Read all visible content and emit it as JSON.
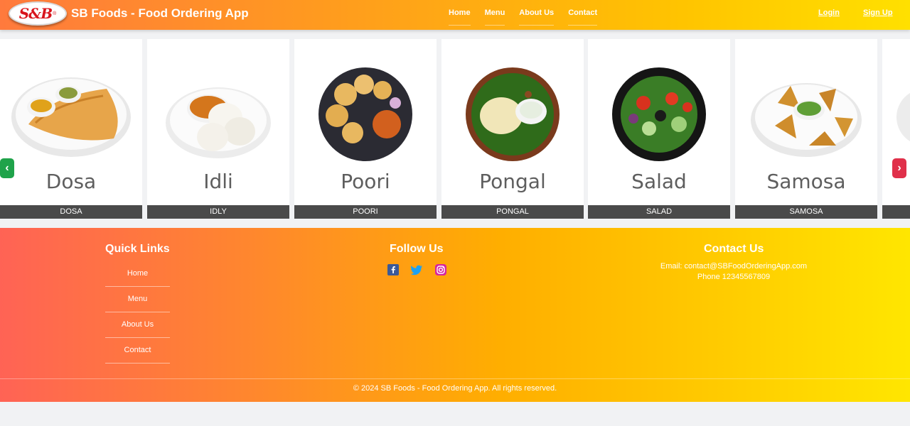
{
  "header": {
    "logo_text": "S&B",
    "brand": "SB Foods - Food Ordering App",
    "nav": [
      "Home",
      "Menu",
      "About Us",
      "Contact"
    ],
    "login": "Login",
    "signup": "Sign Up"
  },
  "carousel": {
    "items": [
      {
        "name": "Dosa",
        "caption": "DOSA"
      },
      {
        "name": "Idli",
        "caption": "IDLY"
      },
      {
        "name": "Poori",
        "caption": "POORI"
      },
      {
        "name": "Pongal",
        "caption": "PONGAL"
      },
      {
        "name": "Salad",
        "caption": "SALAD"
      },
      {
        "name": "Samosa",
        "caption": "SAMOSA"
      }
    ],
    "prev_icon": "‹",
    "next_icon": "›"
  },
  "footer": {
    "quick_links_title": "Quick Links",
    "quick_links": [
      "Home",
      "Menu",
      "About Us",
      "Contact"
    ],
    "follow_title": "Follow Us",
    "social_icons": [
      "facebook-icon",
      "twitter-icon",
      "instagram-icon"
    ],
    "contact_title": "Contact Us",
    "email": "Email: contact@SBFoodOrderingApp.com",
    "phone": "Phone 12345567809",
    "copyright": "© 2024 SB Foods - Food Ordering App. All rights reserved."
  },
  "colors": {
    "header_start": "#ff7a3d",
    "header_end": "#ffe000",
    "caption_bg": "#4a4a4a",
    "prev_arrow": "#1fa34a",
    "next_arrow": "#e0304a"
  }
}
